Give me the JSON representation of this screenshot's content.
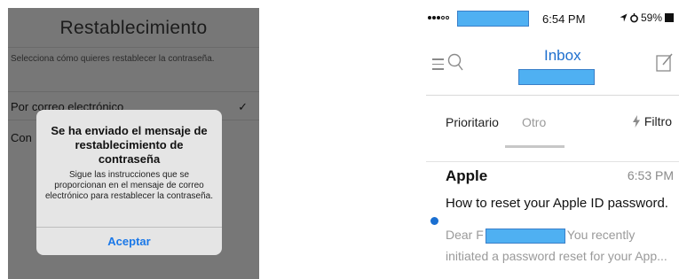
{
  "left": {
    "title": "Restablecimiento",
    "description": "Selecciona cómo quieres restablecer la contraseña.",
    "option_email": "Por correo electrónico",
    "option_other": "Con",
    "checkmark": "✓",
    "alert": {
      "title": "Se ha enviado el mensaje de restablecimiento de contraseña",
      "message": "Sigue las instrucciones que se proporcionan en el mensaje de correo electrónico para restablecer la contraseña.",
      "button": "Aceptar"
    }
  },
  "right": {
    "status": {
      "time": "6:54 PM",
      "battery": "59%"
    },
    "header": {
      "title": "Inbox"
    },
    "tabs": {
      "focused": "Prioritario",
      "other": "Otro",
      "filter": "Filtro"
    },
    "message": {
      "sender": "Apple",
      "time": "6:53 PM",
      "subject": "How to reset your Apple ID password.",
      "preview_start": "Dear F",
      "preview_end": "You recently",
      "preview_line2": "initiated a password reset for your App..."
    }
  },
  "colors": {
    "accent": "#1e6fce",
    "alert_button": "#1a78e8",
    "redaction": "#4fb0f2",
    "dim_overlay": "#777777"
  },
  "icons": [
    "hamburger-icon",
    "search-icon",
    "compose-icon",
    "flash-icon",
    "location-arrow-icon",
    "alarm-icon",
    "battery-icon",
    "checkmark-icon"
  ]
}
